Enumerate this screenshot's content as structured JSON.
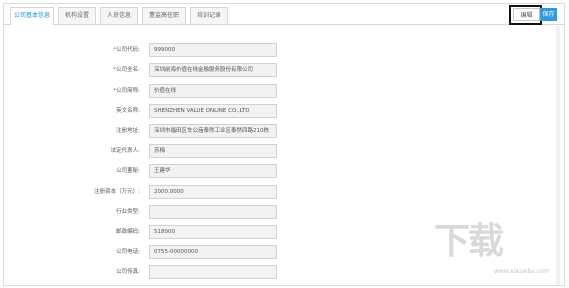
{
  "tabs": [
    {
      "label": "公司基本信息",
      "active": true
    },
    {
      "label": "机构设置",
      "active": false
    },
    {
      "label": "人员信息",
      "active": false
    },
    {
      "label": "董监高任职",
      "active": false
    },
    {
      "label": "培训记录",
      "active": false
    }
  ],
  "toolbar": {
    "edit_label": "编辑",
    "save_label": "保存"
  },
  "form": {
    "rows": [
      {
        "label": "公司代码:",
        "required": true,
        "value": "999000"
      },
      {
        "label": "公司全名:",
        "required": true,
        "value": "深圳前海价值在线金融服务股份有限公司"
      },
      {
        "label": "公司简称:",
        "required": true,
        "value": "价值在线"
      },
      {
        "label": "英文名称:",
        "required": false,
        "value": "SHENZHEN VALUE ONLINE CO.,LTD"
      },
      {
        "label": "注册地址:",
        "required": false,
        "value": "深圳市福田区车公庙泰然工业区泰然四路210栋"
      },
      {
        "label": "法定代表人:",
        "required": false,
        "value": "苏梅"
      },
      {
        "label": "公司董秘:",
        "required": false,
        "value": "王建华"
      },
      {
        "label": "注册资本（万元）:",
        "required": false,
        "value": "2000.0000"
      },
      {
        "label": "行业类型:",
        "required": false,
        "value": ""
      },
      {
        "label": "邮政编码:",
        "required": false,
        "value": "518000"
      },
      {
        "label": "公司电话:",
        "required": false,
        "value": "0755-00000000"
      },
      {
        "label": "公司传真:",
        "required": false,
        "value": ""
      }
    ]
  },
  "watermark": {
    "text": "下载",
    "url": "www.xiazaiba.com"
  }
}
